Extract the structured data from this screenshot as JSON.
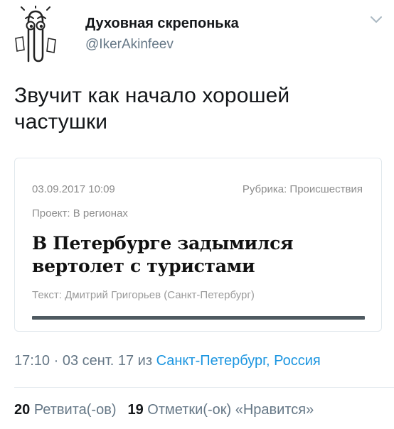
{
  "author": {
    "display_name": "Духовная скрепонька",
    "handle": "@IkerAkinfeev",
    "avatar_icon": "paperclip-mascot-icon"
  },
  "tweet": {
    "text": "Звучит как начало хорошей частушки"
  },
  "card": {
    "date": "03.09.2017 10:09",
    "rubric": "Рубрика: Происшествия",
    "project": "Проект: В регионах",
    "headline": "В Петербурге задымился вертолет с туристами",
    "author": "Текст: Дмитрий Григорьев (Санкт-Петербург)"
  },
  "meta": {
    "time": "17:10",
    "separator": " · ",
    "date": "03 сент. 17",
    "from_word": " из ",
    "location": "Санкт-Петербург, Россия"
  },
  "stats": {
    "retweets_count": "20",
    "retweets_label": "Ретвита(-ов)",
    "likes_count": "19",
    "likes_label": "Отметки(-ок) «Нравится»"
  },
  "colors": {
    "primary_text": "#14171a",
    "secondary_text": "#657786",
    "link": "#1b95e0",
    "card_border": "#e1e8ed"
  }
}
